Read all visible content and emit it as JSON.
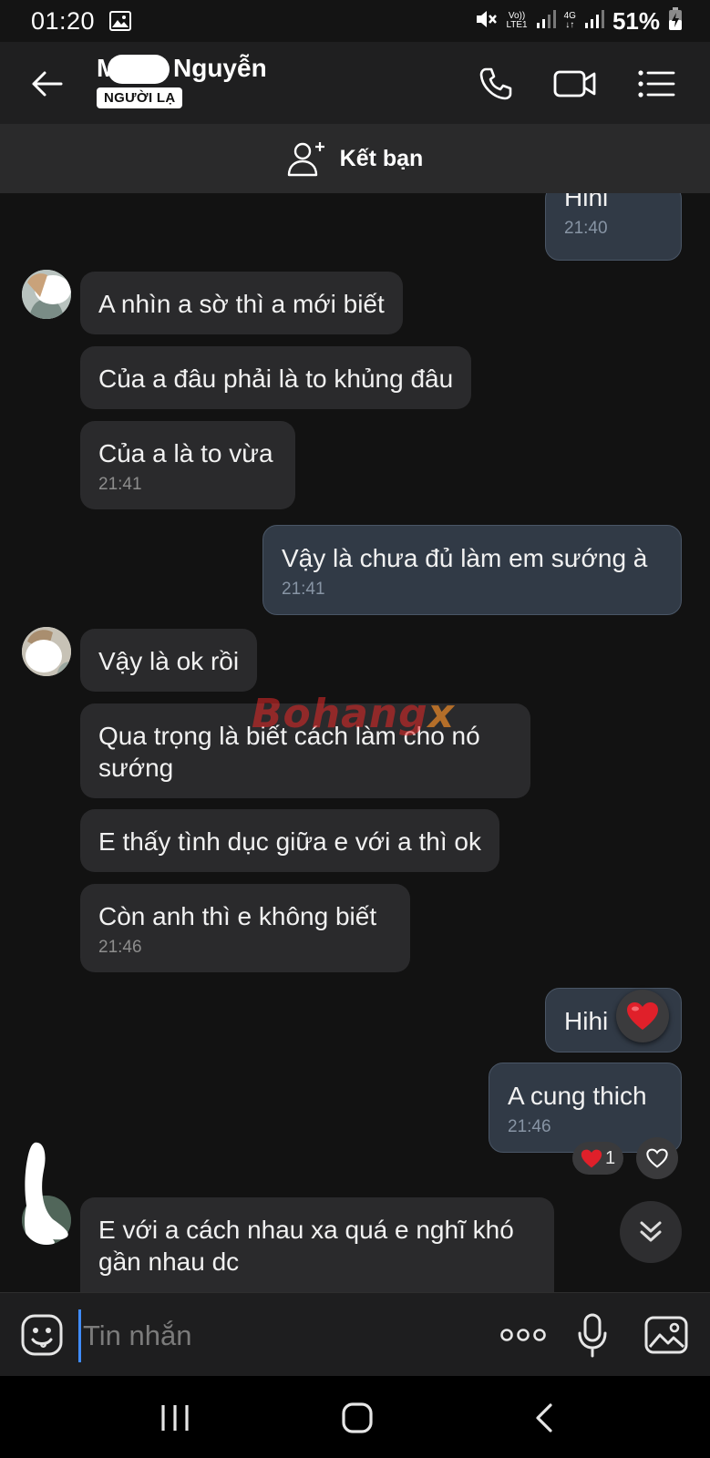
{
  "status_bar": {
    "time": "01:20",
    "net_top": "Vo))",
    "net_bottom": "LTE1",
    "net4g_top": "4G",
    "net4g_bottom": "↓↑",
    "battery": "51%"
  },
  "header": {
    "contact_name_visible": "Nguyễn",
    "stranger_badge": "NGƯỜI LẠ"
  },
  "add_friend": {
    "label": "Kết bạn"
  },
  "messages": [
    {
      "id": "m0",
      "direction": "out",
      "text": "Hihi",
      "time": "21:40"
    },
    {
      "id": "m1",
      "direction": "in",
      "text": "A nhìn a sờ thì a mới biết"
    },
    {
      "id": "m2",
      "direction": "in",
      "text": "Của a đâu phải là to khủng đâu"
    },
    {
      "id": "m3",
      "direction": "in",
      "text": "Của a là to vừa",
      "time": "21:41"
    },
    {
      "id": "m4",
      "direction": "out",
      "text": "Vậy là chưa đủ làm em sướng à",
      "time": "21:41"
    },
    {
      "id": "m5",
      "direction": "in",
      "text": "Vậy là ok rồi"
    },
    {
      "id": "m6",
      "direction": "in",
      "text": "Qua trọng là biết cách làm cho nó sướng"
    },
    {
      "id": "m7",
      "direction": "in",
      "text": "E thấy tình dục giữa e với a thì ok"
    },
    {
      "id": "m8",
      "direction": "in",
      "text": "Còn anh thì e không biết",
      "time": "21:46"
    },
    {
      "id": "m9",
      "direction": "out",
      "text": "Hihi"
    },
    {
      "id": "m10",
      "direction": "out",
      "text": "A cung thich",
      "time": "21:46"
    },
    {
      "id": "m11",
      "direction": "in",
      "text": "E với a cách nhau xa quá e nghĩ khó gần nhau dc"
    }
  ],
  "reactions": {
    "m9_reaction": "heart",
    "m10_count": "1"
  },
  "watermark": {
    "main": "Bohang",
    "suffix": "x"
  },
  "input": {
    "placeholder": "Tin nhắn"
  },
  "colors": {
    "incoming_bubble": "#2a2a2c",
    "outgoing_bubble": "#313a46",
    "accent": "#3f8cff",
    "heart": "#e0202a"
  }
}
